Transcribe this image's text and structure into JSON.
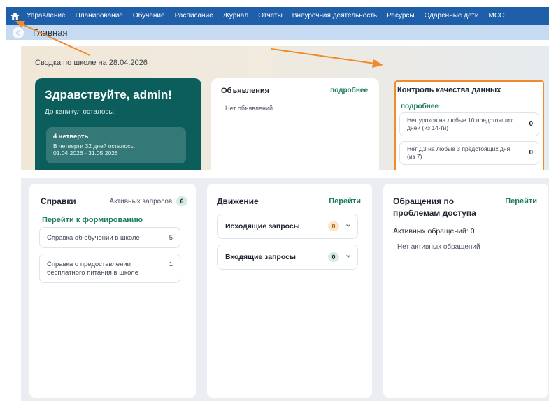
{
  "nav": {
    "items": [
      "Управление",
      "Планирование",
      "Обучение",
      "Расписание",
      "Журнал",
      "Отчеты",
      "Внеурочная деятельность",
      "Ресурсы",
      "Одаренные дети",
      "МСО"
    ]
  },
  "breadcrumb": {
    "current": "Главная"
  },
  "summary": {
    "title": "Сводка по школе на 28.04.2026",
    "greeting": "Здравствуйте, admin!",
    "vacation_label": "До каникул осталось:",
    "quarter": {
      "title": "4 четверть",
      "days_left": "В четверти 32 дней осталось.",
      "period": "01.04.2026 - 31.05.2026"
    }
  },
  "announcements": {
    "title": "Объявления",
    "more": "подробнее",
    "empty": "Нет объявлений"
  },
  "data_quality": {
    "title": "Контроль качества данных",
    "more": "подробнее",
    "items": [
      {
        "text": "Нет уроков на любые 10 предстоящих дней (из 14-ти)",
        "count": "0"
      },
      {
        "text": "Нет ДЗ на любые 3 предстоящих дня (из 7)",
        "count": "0"
      }
    ]
  },
  "references": {
    "title": "Справки",
    "active_label": "Активных запросов:",
    "active_count": "6",
    "link": "Перейти к формированию",
    "items": [
      {
        "text": "Справка об обучении в школе",
        "count": "5"
      },
      {
        "text": "Справка о предоставлении бесплатного питания в школе",
        "count": "1"
      }
    ]
  },
  "movement": {
    "title": "Движение",
    "link": "Перейти",
    "outgoing": {
      "label": "Исходящие запросы",
      "count": "0"
    },
    "incoming": {
      "label": "Входящие запросы",
      "count": "0"
    }
  },
  "access": {
    "title": "Обращения по проблемам доступа",
    "link": "Перейти",
    "active": "Активных обращений: 0",
    "empty": "Нет активных обращений"
  },
  "colors": {
    "nav": "#1f5ea8",
    "accent_green": "#1d7d5f",
    "hello_card": "#0b5e5c",
    "highlight": "#f08a2a"
  },
  "icons": [
    "home-icon",
    "back-arrow-icon",
    "chevron-down-icon"
  ]
}
